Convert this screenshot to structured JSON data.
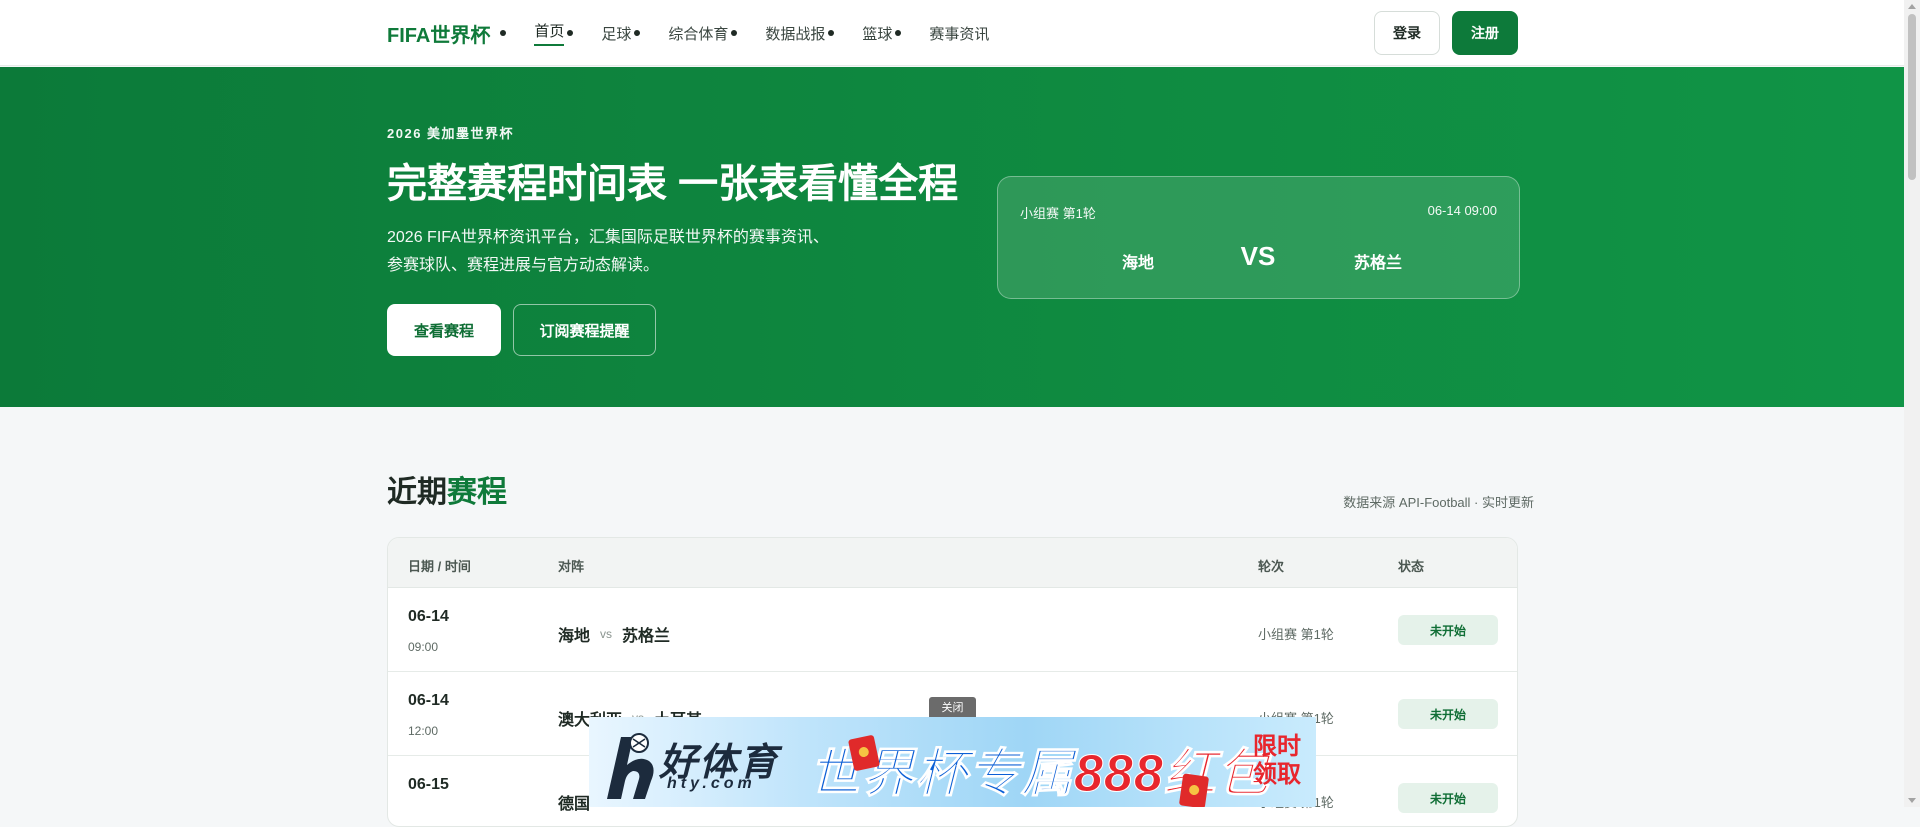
{
  "nav": {
    "logo": "FIFA世界杯",
    "items": [
      {
        "label": "首页",
        "dot": true,
        "active": true
      },
      {
        "label": "足球",
        "dot": true
      },
      {
        "label": "综合体育",
        "dot": true
      },
      {
        "label": "数据战报",
        "dot": true
      },
      {
        "label": "篮球",
        "dot": true
      },
      {
        "label": "赛事资讯",
        "dot": false
      }
    ],
    "login": "登录",
    "register": "注册"
  },
  "hero": {
    "eyebrow": "2026 美加墨世界杯",
    "title": "完整赛程时间表 一张表看懂全程",
    "desc": "2026 FIFA世界杯资讯平台，汇集国际足联世界杯的赛事资讯、参赛球队、赛程进展与官方动态解读。",
    "primary_btn": "查看赛程",
    "ghost_btn": "订阅赛程提醒",
    "card": {
      "stage": "小组赛 第1轮",
      "time": "06-14 09:00",
      "home": "海地",
      "vs": "VS",
      "away": "苏格兰"
    }
  },
  "schedule": {
    "title_prefix": "近期",
    "title_highlight": "赛程",
    "meta": "数据来源 API-Football · 实时更新",
    "headers": {
      "date": "日期 / 时间",
      "match": "对阵",
      "round": "轮次",
      "status": "状态"
    },
    "rows": [
      {
        "date": "06-14",
        "time": "09:00",
        "home": "海地",
        "vs": "vs",
        "away": "苏格兰",
        "round": "小组赛 第1轮",
        "status": "未开始"
      },
      {
        "date": "06-14",
        "time": "12:00",
        "home": "澳大利亚",
        "vs": "vs",
        "away": "土耳其",
        "round": "小组赛 第1轮",
        "status": "未开始"
      },
      {
        "date": "06-15",
        "time": "",
        "home": "德国",
        "vs": "",
        "away": "",
        "round": "小组赛 第1轮",
        "status": "未开始"
      }
    ]
  },
  "ad": {
    "close": "关闭",
    "brand": "好体育",
    "domain": "hty.com",
    "slogan_part1": "世界杯专属",
    "slogan_part2": "888红包",
    "limit": "限时领取"
  },
  "colors": {
    "brand_green": "#0f7a3a",
    "status_bg": "#e5f2ea",
    "ad_red": "#e8262d",
    "ad_blue": "#0b5fd6"
  }
}
